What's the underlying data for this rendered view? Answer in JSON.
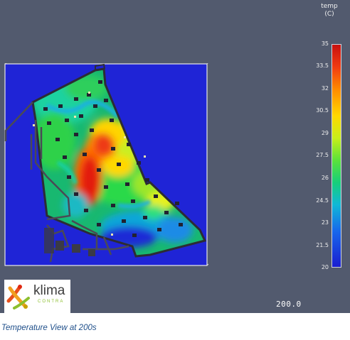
{
  "legend": {
    "title_line1": "temp",
    "title_line2": "(C)",
    "ticks": [
      "35",
      "33.5",
      "32",
      "30.5",
      "29",
      "27.5",
      "26",
      "24.5",
      "23",
      "21.5",
      "20"
    ]
  },
  "colors": {
    "background": "#525a6e",
    "domain_fill": "#1f24d6",
    "hot": "#e31e10",
    "cold": "#1a1ed0",
    "caption": "#1f4f8a"
  },
  "time_display": "200.0",
  "logo": {
    "text": "klima",
    "subtext": "CONTRA"
  },
  "caption": "Temperature View at 200s"
}
